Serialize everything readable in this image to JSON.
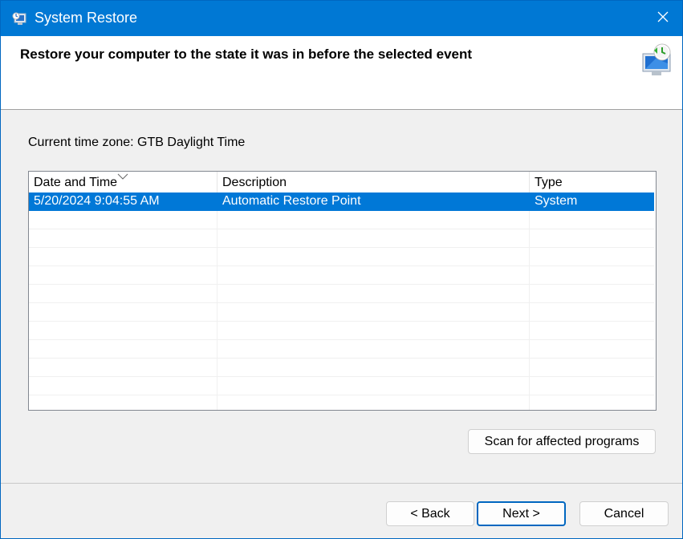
{
  "window": {
    "title": "System Restore",
    "accent_color": "#0078d4",
    "icons": {
      "title": "system-restore-icon",
      "close": "close-icon"
    }
  },
  "header": {
    "title": "Restore your computer to the state it was in before the selected event",
    "icon": "system-restore-icon"
  },
  "timezone_label": "Current time zone: GTB Daylight Time",
  "list": {
    "columns": [
      "Date and Time",
      "Description",
      "Type"
    ],
    "sorted_column": "Date and Time",
    "sort_icon": "chevron-down-icon",
    "rows": [
      {
        "date": "5/20/2024 9:04:55 AM",
        "description": "Automatic Restore Point",
        "type": "System",
        "selected": true
      }
    ],
    "selection_color": "#0078d7"
  },
  "buttons": {
    "scan": "Scan for affected programs",
    "back": "< Back",
    "next": "Next >",
    "cancel": "Cancel"
  }
}
